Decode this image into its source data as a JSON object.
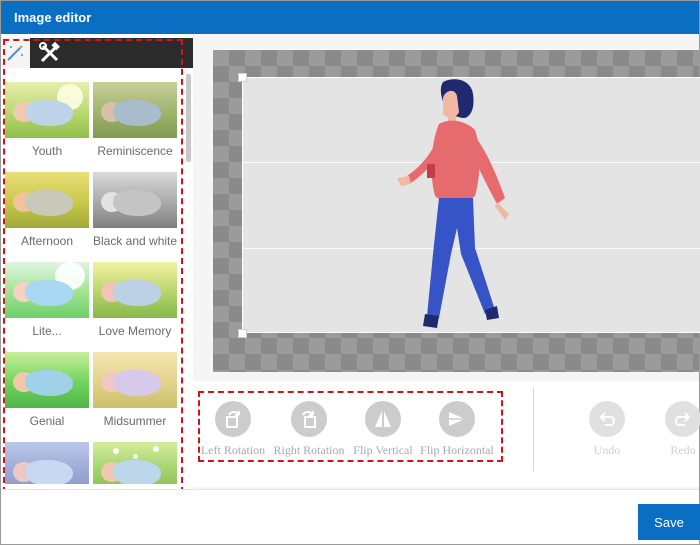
{
  "window": {
    "title": "Image editor"
  },
  "sidebar": {
    "tabs": [
      {
        "icon": "magic-wand-icon"
      },
      {
        "icon": "tools-icon"
      }
    ],
    "filters": [
      {
        "label": "Youth"
      },
      {
        "label": "Reminiscence"
      },
      {
        "label": "Afternoon"
      },
      {
        "label": "Black and white"
      },
      {
        "label": "Lite..."
      },
      {
        "label": "Love Memory"
      },
      {
        "label": "Genial"
      },
      {
        "label": "Midsummer"
      },
      {
        "label": ""
      },
      {
        "label": ""
      }
    ]
  },
  "toolbar": {
    "left_rotation": "Left Rotation",
    "right_rotation": "Right Rotation",
    "flip_vertical": "Flip Vertical",
    "flip_horizontal": "Flip Horizontal",
    "undo": "Undo",
    "redo": "Redo"
  },
  "footer": {
    "save_label": "Save"
  },
  "colors": {
    "accent": "#0a6fc2",
    "highlight": "#d0141b"
  }
}
